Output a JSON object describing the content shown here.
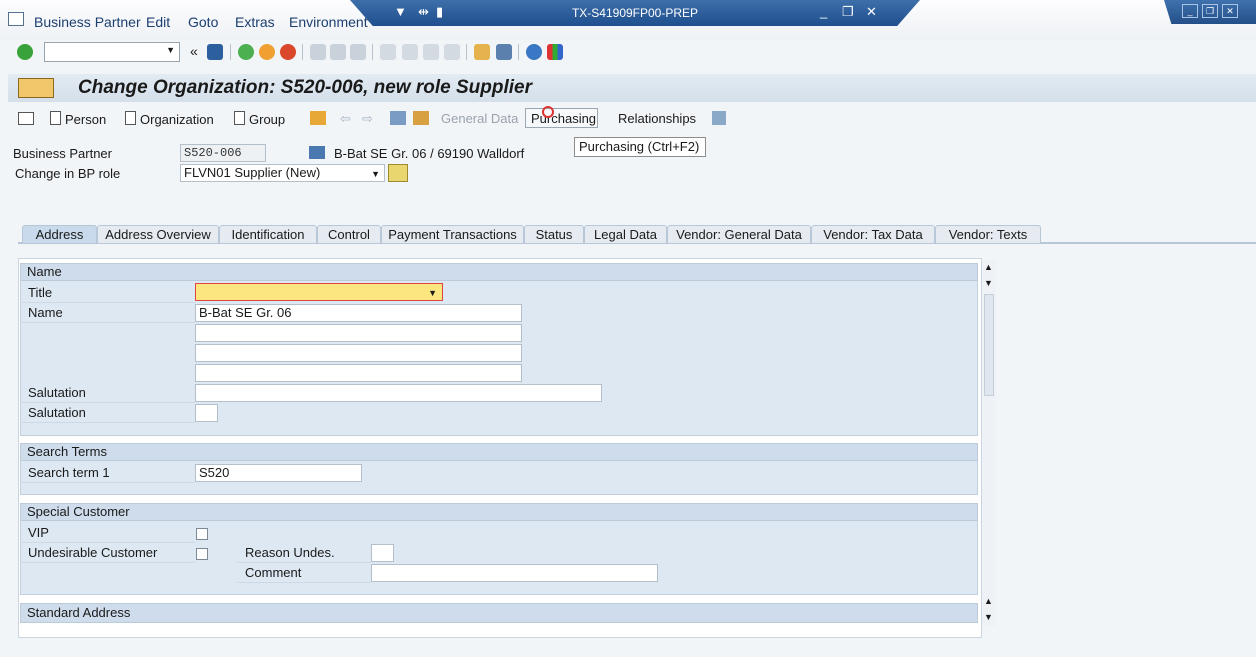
{
  "menu": [
    "Business Partner",
    "Edit",
    "Goto",
    "Extras",
    "Environment"
  ],
  "window_title": "TX-S41909FP00-PREP",
  "page_title": "Change Organization: S520-006, new role Supplier",
  "app_toolbar": {
    "person": "Person",
    "organization": "Organization",
    "group": "Group",
    "general_data": "General Data",
    "purchasing": "Purchasing",
    "relationships": "Relationships"
  },
  "tooltip": "Purchasing   (Ctrl+F2)",
  "header": {
    "bp_label": "Business Partner",
    "bp_value": "S520-006",
    "bp_desc": "B-Bat SE Gr. 06 / 69190 Walldorf",
    "role_label": "Change in BP role",
    "role_value": "FLVN01 Supplier (New)"
  },
  "tabs": [
    "Address",
    "Address Overview",
    "Identification",
    "Control",
    "Payment Transactions",
    "Status",
    "Legal Data",
    "Vendor: General Data",
    "Vendor: Tax Data",
    "Vendor: Texts"
  ],
  "name_group": {
    "title": "Name",
    "title_label": "Title",
    "name_label": "Name",
    "name_value": "B-Bat SE Gr. 06",
    "salutation_label": "Salutation",
    "salutation2_label": "Salutation"
  },
  "search_group": {
    "title": "Search Terms",
    "term1_label": "Search term 1",
    "term1_value": "S520"
  },
  "special_group": {
    "title": "Special Customer",
    "vip_label": "VIP",
    "undes_label": "Undesirable Customer",
    "reason_label": "Reason Undes.",
    "comment_label": "Comment"
  },
  "address_group": {
    "title": "Standard Address"
  }
}
